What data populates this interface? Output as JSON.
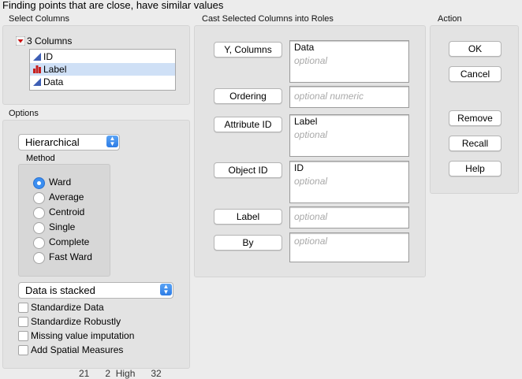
{
  "title": "Finding points that are close, have similar values",
  "select_columns": {
    "section_label": "Select Columns",
    "count_label": "3 Columns",
    "columns": [
      {
        "name": "ID",
        "icon": "continuous-column-icon",
        "selected": false
      },
      {
        "name": "Label",
        "icon": "nominal-column-icon",
        "selected": true
      },
      {
        "name": "Data",
        "icon": "continuous-column-icon",
        "selected": false
      }
    ]
  },
  "options": {
    "section_label": "Options",
    "clustering_type": "Hierarchical",
    "method_label": "Method",
    "methods": [
      {
        "label": "Ward",
        "selected": true
      },
      {
        "label": "Average",
        "selected": false
      },
      {
        "label": "Centroid",
        "selected": false
      },
      {
        "label": "Single",
        "selected": false
      },
      {
        "label": "Complete",
        "selected": false
      },
      {
        "label": "Fast Ward",
        "selected": false
      }
    ],
    "data_format": "Data is stacked",
    "checkboxes": [
      {
        "label": "Standardize Data",
        "checked": false
      },
      {
        "label": "Standardize Robustly",
        "checked": false
      },
      {
        "label": "Missing value imputation",
        "checked": false
      },
      {
        "label": "Add Spatial Measures",
        "checked": false
      }
    ]
  },
  "roles": {
    "section_label": "Cast Selected Columns into Roles",
    "items": [
      {
        "button": "Y, Columns",
        "value": "Data",
        "placeholder": "optional"
      },
      {
        "button": "Ordering",
        "value": "",
        "placeholder": "optional numeric"
      },
      {
        "button": "Attribute ID",
        "value": "Label",
        "placeholder": "optional"
      },
      {
        "button": "Object ID",
        "value": "ID",
        "placeholder": "optional"
      },
      {
        "button": "Label",
        "value": "",
        "placeholder": "optional"
      },
      {
        "button": "By",
        "value": "",
        "placeholder": "optional"
      }
    ]
  },
  "action": {
    "section_label": "Action",
    "buttons": [
      "OK",
      "Cancel",
      "Remove",
      "Recall",
      "Help"
    ]
  },
  "background_partial_row": "21      2  High      32",
  "colors": {
    "selection": "#cfe0f6",
    "accent": "#3b8ef0",
    "red_triangle": "#cc1111"
  }
}
